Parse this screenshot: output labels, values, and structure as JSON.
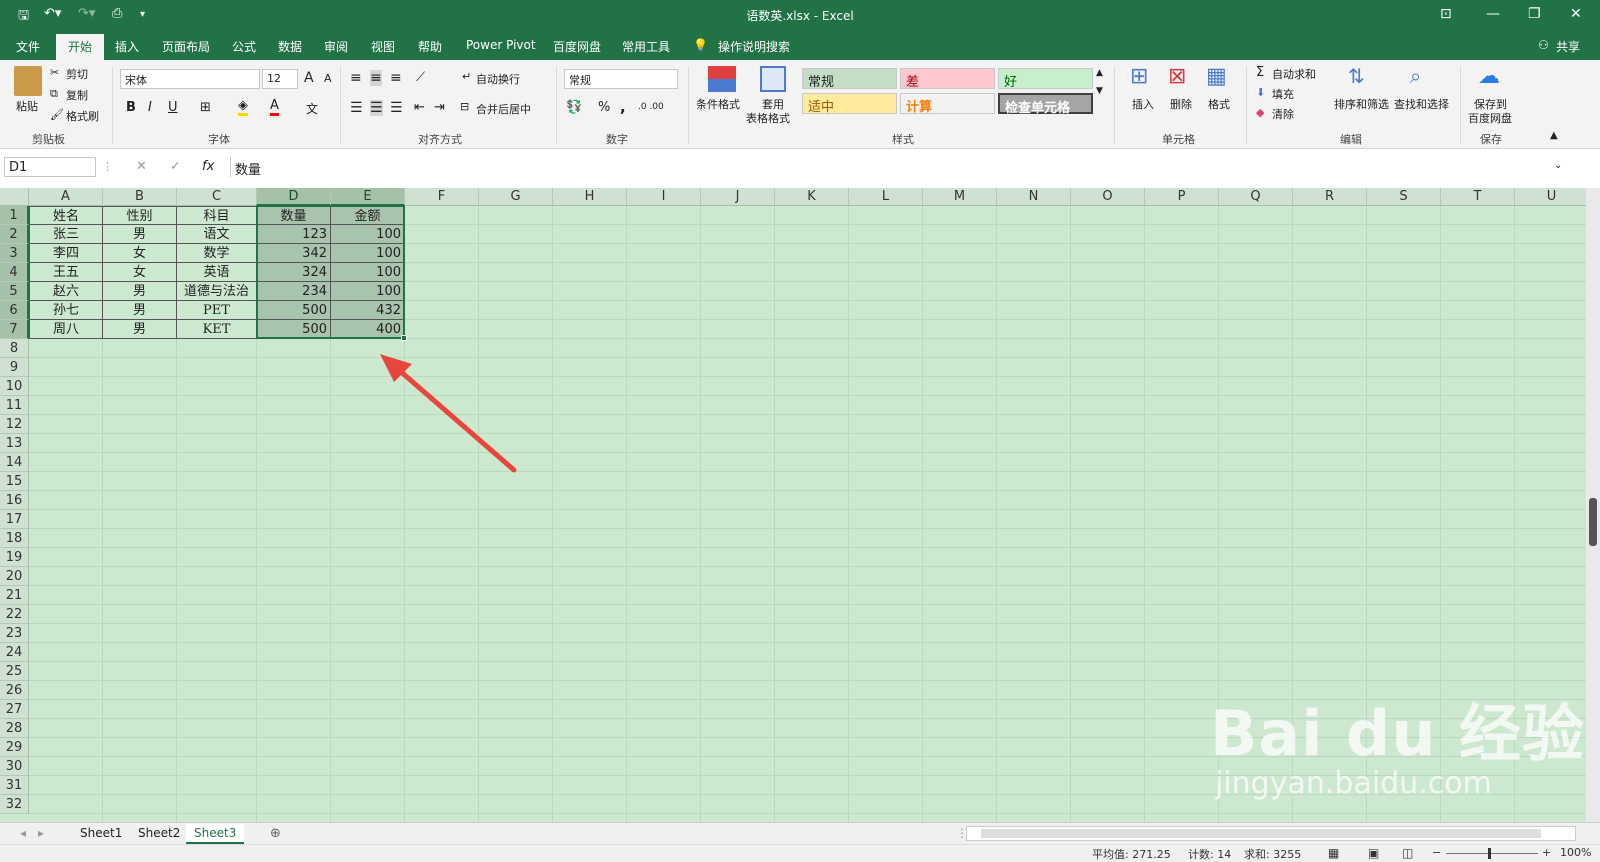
{
  "title": {
    "file": "语数英.xlsx",
    "app": "Excel",
    "sep": " - "
  },
  "quick_access": {
    "save_icon": "save-icon",
    "undo_icon": "undo-icon",
    "redo_icon": "redo-icon",
    "preview_icon": "print-preview-icon"
  },
  "tabs": [
    "文件",
    "开始",
    "插入",
    "页面布局",
    "公式",
    "数据",
    "审阅",
    "视图",
    "帮助",
    "Power Pivot",
    "百度网盘",
    "常用工具"
  ],
  "tell_me": "操作说明搜索",
  "share": "共享",
  "ribbon": {
    "clipboard": {
      "paste": "粘贴",
      "cut": "剪切",
      "copy": "复制",
      "format_painter": "格式刷",
      "label": "剪贴板"
    },
    "font": {
      "name": "宋体",
      "size": "12",
      "bold": "B",
      "italic": "I",
      "underline": "U",
      "grow": "A",
      "shrink": "A",
      "font_color": "A",
      "wen": "文",
      "label": "字体"
    },
    "align": {
      "wrap": "自动换行",
      "merge": "合并后居中",
      "label": "对齐方式"
    },
    "number": {
      "format": "常规",
      "percent": "%",
      "comma": ",",
      "inc": ".0 .00",
      "label": "数字"
    },
    "styles": {
      "cond": "条件格式",
      "table1": "套用",
      "table2": "表格格式",
      "normal": "常规",
      "bad": "差",
      "good": "好",
      "neutral": "适中",
      "calc": "计算",
      "check": "检查单元格",
      "label": "样式"
    },
    "cells": {
      "insert": "插入",
      "delete": "删除",
      "format": "格式",
      "label": "单元格"
    },
    "editing": {
      "autosum": "自动求和",
      "fill": "填充",
      "clear": "清除",
      "sort": "排序和筛选",
      "find": "查找和选择",
      "label": "编辑"
    },
    "save": {
      "line1": "保存到",
      "line2": "百度网盘",
      "label": "保存"
    }
  },
  "formula_bar": {
    "name_box": "D1",
    "fx": "fx",
    "cancel": "✕",
    "enter": "✓",
    "content": "数量"
  },
  "columns": [
    "A",
    "B",
    "C",
    "D",
    "E",
    "F",
    "G",
    "H",
    "I",
    "J",
    "K",
    "L",
    "M",
    "N",
    "O",
    "P",
    "Q",
    "R",
    "S",
    "T",
    "U"
  ],
  "rows": [
    "1",
    "2",
    "3",
    "4",
    "5",
    "6",
    "7",
    "8",
    "9",
    "10",
    "11",
    "12",
    "13",
    "14",
    "15",
    "16",
    "17",
    "18",
    "19",
    "20",
    "21",
    "22",
    "23",
    "24",
    "25",
    "26",
    "27",
    "28",
    "29",
    "30",
    "31",
    "32"
  ],
  "table": [
    [
      "姓名",
      "性别",
      "科目",
      "数量",
      "金额"
    ],
    [
      "张三",
      "男",
      "语文",
      "123",
      "100"
    ],
    [
      "李四",
      "女",
      "数学",
      "342",
      "100"
    ],
    [
      "王五",
      "女",
      "英语",
      "324",
      "100"
    ],
    [
      "赵六",
      "男",
      "道德与法治",
      "234",
      "100"
    ],
    [
      "孙七",
      "男",
      "PET",
      "500",
      "432"
    ],
    [
      "周八",
      "男",
      "KET",
      "500",
      "400"
    ]
  ],
  "sheets": [
    "Sheet1",
    "Sheet2",
    "Sheet3"
  ],
  "active_sheet": "Sheet3",
  "status": {
    "avg": "平均值: 271.25",
    "count": "计数: 14",
    "sum": "求和: 3255",
    "zoom": "100%"
  },
  "watermark": {
    "logo": "Bai du 经验",
    "url": "jingyan.baidu.com"
  },
  "colors": {
    "excel_green": "#217346",
    "grid_bg": "#cce8cf",
    "arrow": "#e8453c"
  }
}
